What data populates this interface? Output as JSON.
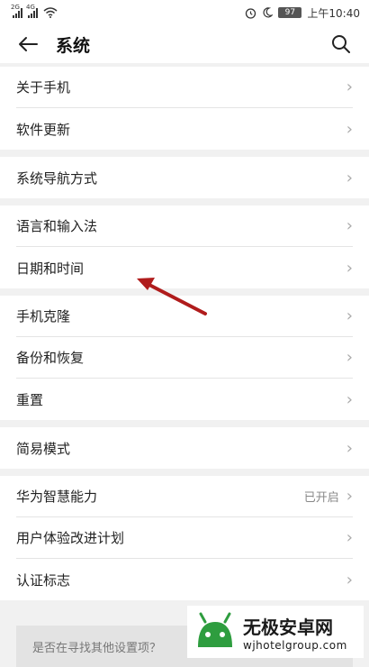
{
  "status_bar": {
    "signal1_tag": "2G",
    "signal2_tag": "4G",
    "battery": "97",
    "time": "上午10:40",
    "alarm_icon": "alarm-icon",
    "dnd_icon": "moon-icon"
  },
  "header": {
    "title": "系统",
    "back_icon": "back-arrow-icon",
    "search_icon": "search-icon"
  },
  "groups": [
    {
      "items": [
        {
          "label": "关于手机"
        },
        {
          "label": "软件更新"
        }
      ]
    },
    {
      "items": [
        {
          "label": "系统导航方式"
        }
      ]
    },
    {
      "items": [
        {
          "label": "语言和输入法"
        },
        {
          "label": "日期和时间"
        }
      ]
    },
    {
      "items": [
        {
          "label": "手机克隆"
        },
        {
          "label": "备份和恢复"
        },
        {
          "label": "重置"
        }
      ]
    },
    {
      "items": [
        {
          "label": "简易模式"
        }
      ]
    },
    {
      "items": [
        {
          "label": "华为智慧能力",
          "value": "已开启"
        },
        {
          "label": "用户体验改进计划"
        },
        {
          "label": "认证标志"
        }
      ]
    }
  ],
  "search_hint": "是否在寻找其他设置项？",
  "annotation": {
    "color": "#b01c1c"
  },
  "watermark": {
    "name": "无极安卓网",
    "url": "wjhotelgroup.com"
  }
}
